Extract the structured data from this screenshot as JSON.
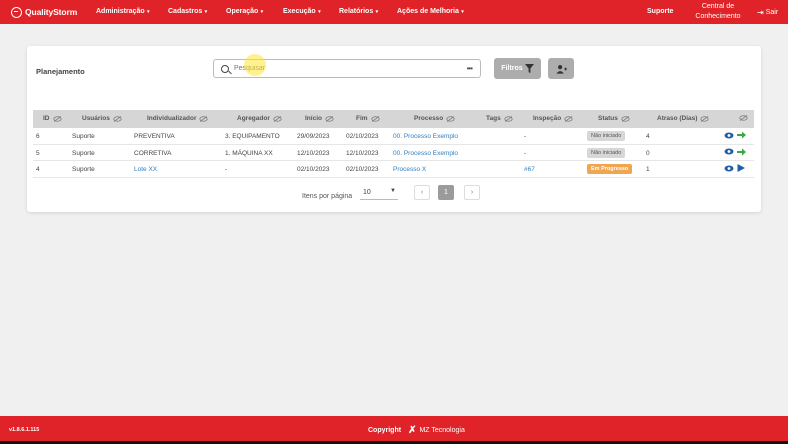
{
  "navbar": {
    "brand": "QualityStorm",
    "menu": [
      {
        "label": "Administração"
      },
      {
        "label": "Cadastros"
      },
      {
        "label": "Operação"
      },
      {
        "label": "Execução"
      },
      {
        "label": "Relatórios"
      },
      {
        "label": "Ações de Melhoria"
      }
    ],
    "support": "Suporte",
    "knowledge_line1": "Central de",
    "knowledge_line2": "Conhecimento",
    "exit": "Sair"
  },
  "page": {
    "title": "Planejamento",
    "search_placeholder": "Pesquisar",
    "filters_label": "Filtros"
  },
  "table": {
    "headers": [
      "ID",
      "Usuários",
      "Individualizador",
      "Agregador",
      "Início",
      "Fim",
      "Processo",
      "Tags",
      "Inspeção",
      "Status",
      "Atraso (Dias)"
    ],
    "rows": [
      {
        "id": "6",
        "usuario": "Suporte",
        "individualizador": "PREVENTIVA",
        "agregador": "3. EQUIPAMENTO",
        "inicio": "29/09/2023",
        "fim": "02/10/2023",
        "processo": "00. Processo Exemplo",
        "tags": "",
        "inspecao": "-",
        "status": "Não iniciado",
        "atraso": "4"
      },
      {
        "id": "5",
        "usuario": "Suporte",
        "individualizador": "CORRETIVA",
        "agregador": "1. MÁQUINA XX",
        "inicio": "12/10/2023",
        "fim": "12/10/2023",
        "processo": "00. Processo Exemplo",
        "tags": "",
        "inspecao": "-",
        "status": "Não iniciado",
        "atraso": "0"
      },
      {
        "id": "4",
        "usuario": "Suporte",
        "individualizador": "Lote XX",
        "agregador": "-",
        "inicio": "02/10/2023",
        "fim": "02/10/2023",
        "processo": "Processo X",
        "tags": "",
        "inspecao": "#67",
        "status": "Em Progresso",
        "atraso": "1"
      }
    ]
  },
  "pagination": {
    "items_per_page_label": "Itens por página",
    "items_per_page": "10",
    "prev": "‹",
    "current": "1",
    "next": "›"
  },
  "footer": {
    "version": "v1.8.6.1.115",
    "copyright": "Copyright",
    "company": "MZ Tecnologia"
  },
  "colors": {
    "brand_red": "#e02328",
    "link_blue": "#2f7ec0",
    "status_grey": "#d7d7d7",
    "status_orange": "#f0a550",
    "action_green": "#3aa845",
    "action_blue": "#1f5fa8"
  }
}
